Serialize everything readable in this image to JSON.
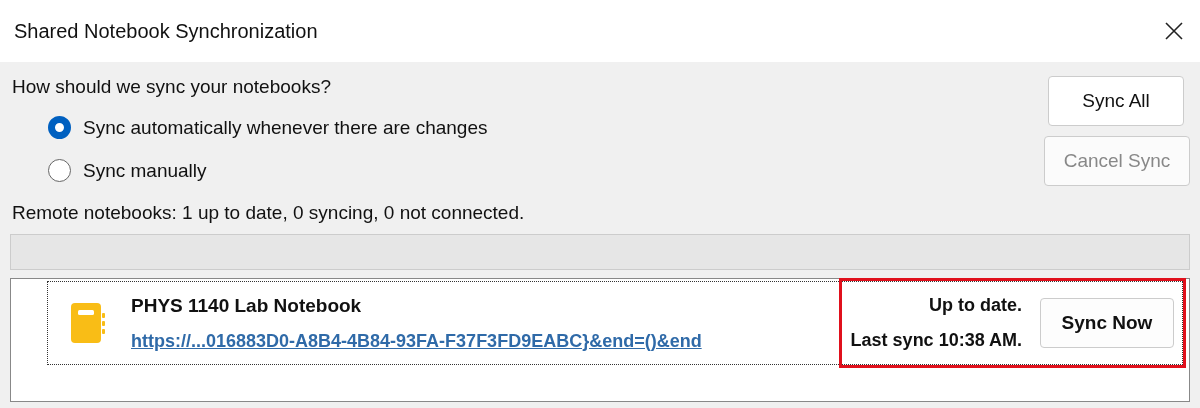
{
  "window": {
    "title": "Shared Notebook Synchronization"
  },
  "question": "How should we sync your notebooks?",
  "options": [
    {
      "label": "Sync automatically whenever there are changes",
      "selected": true
    },
    {
      "label": "Sync manually",
      "selected": false
    }
  ],
  "summary": "Remote notebooks: 1 up to date, 0 syncing, 0 not connected.",
  "buttons": [
    {
      "label": "Sync All",
      "disabled": false
    },
    {
      "label": "Cancel Sync",
      "disabled": true
    }
  ],
  "notebooks": [
    {
      "name": "PHYS 1140 Lab Notebook",
      "link": "https://...016883D0-A8B4-4B84-93FA-F37F3FD9EABC}&end=()&end",
      "status": "Up to date.",
      "last_sync": "Last sync 10:38 AM.",
      "button": "Sync Now",
      "highlighted": true
    }
  ]
}
